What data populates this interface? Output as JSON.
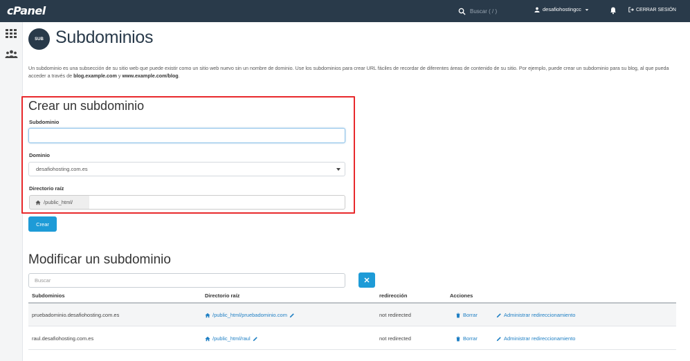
{
  "topbar": {
    "logo": "cPanel",
    "search_placeholder": "Buscar ( / )",
    "user": "desafiohostingcc",
    "logout": "CERRAR SESIÓN"
  },
  "page": {
    "title_icon_text": "SUB",
    "title": "Subdominios",
    "intro_part1": "Un subdominio es una subsección de su sitio web que puede existir como un sitio web nuevo sin un nombre de dominio. Use los subdominios para crear URL fáciles de recordar de diferentes áreas de contenido de su sitio. Por ejemplo, puede crear un subdominio para su blog, al que pueda acceder a través de ",
    "intro_ex1": "blog.example.com",
    "intro_and": " y ",
    "intro_ex2": "www.example.com/blog",
    "intro_end": "."
  },
  "create": {
    "heading": "Crear un subdominio",
    "subdomain_label": "Subdominio",
    "subdomain_value": "",
    "domain_label": "Dominio",
    "domain_selected": "desafiohosting.com.es",
    "docroot_label": "Directorio raíz",
    "docroot_prefix": "/public_html/",
    "docroot_value": "",
    "submit": "Crear"
  },
  "modify": {
    "heading": "Modificar un subdominio",
    "search_placeholder": "Buscar",
    "columns": [
      "Subdominios",
      "Directorio raíz",
      "redirección",
      "Acciones"
    ],
    "rows": [
      {
        "subdomain": "pruebadominio.desafiohosting.com.es",
        "docroot": "/public_html/pruebadominio.com",
        "redirect": "not redirected",
        "delete": "Borrar",
        "manage": "Administrar redireccionamiento"
      },
      {
        "subdomain": "raul.desafiohosting.com.es",
        "docroot": "/public_html/raul",
        "redirect": "not redirected",
        "delete": "Borrar",
        "manage": "Administrar redireccionamiento"
      }
    ]
  },
  "colors": {
    "topbar": "#293a4a",
    "accent": "#1e9bd7",
    "highlight": "#e8282b"
  }
}
